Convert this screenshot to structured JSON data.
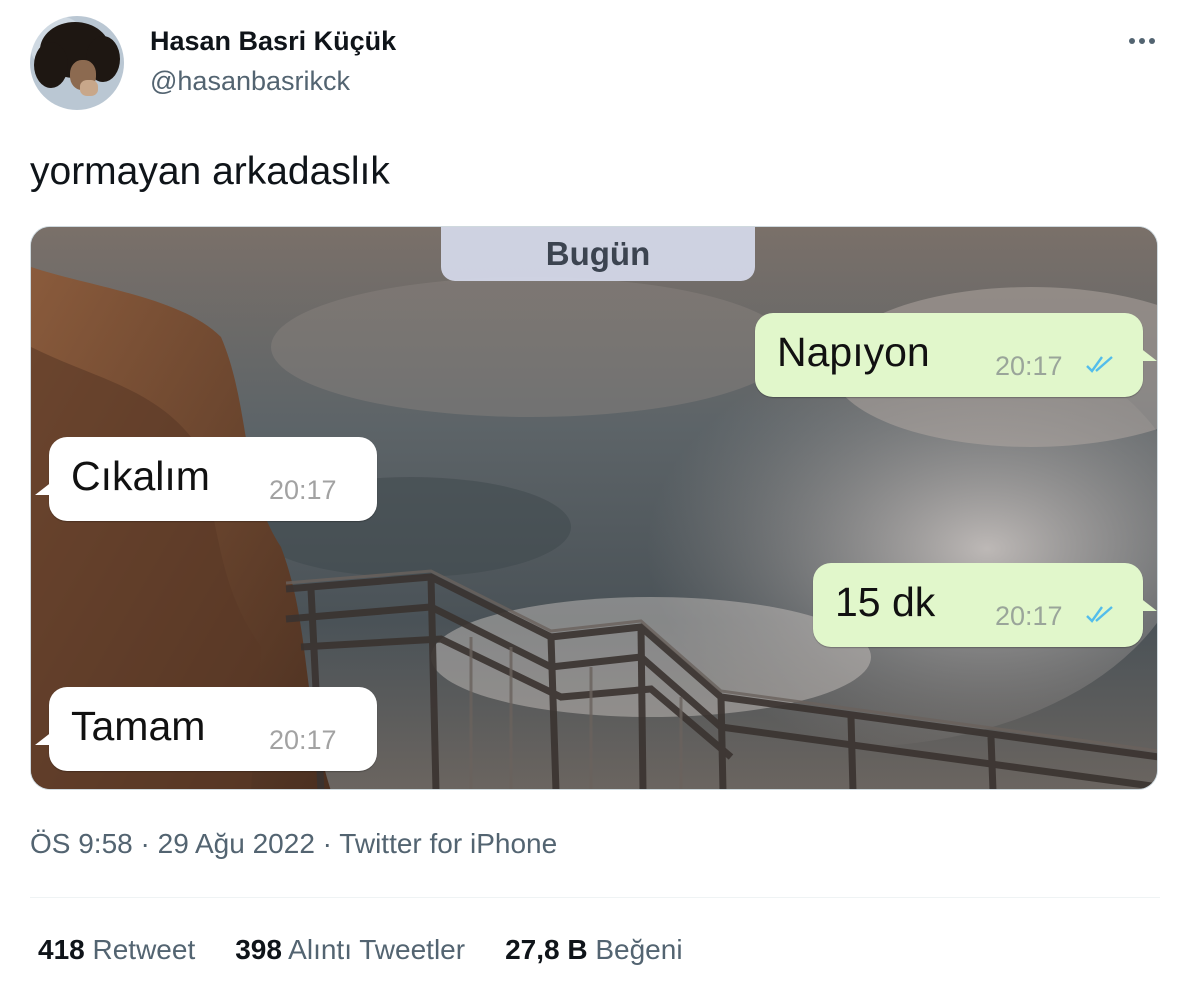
{
  "author": {
    "name": "Hasan Basri Küçük",
    "handle": "@hasanbasrikck"
  },
  "tweet": {
    "text": "yormayan arkadaslık"
  },
  "chat": {
    "date_chip": "Bugün",
    "messages": [
      {
        "direction": "out",
        "text": "Napıyon",
        "time": "20:17",
        "status": "read"
      },
      {
        "direction": "in",
        "text": "Cıkalım",
        "time": "20:17"
      },
      {
        "direction": "out",
        "text": "15 dk",
        "time": "20:17",
        "status": "read"
      },
      {
        "direction": "in",
        "text": "Tamam",
        "time": "20:17"
      }
    ],
    "colors": {
      "outgoing_bubble": "#e1f7cb",
      "incoming_bubble": "#ffffff",
      "read_ticks": "#53bdeb"
    }
  },
  "meta": {
    "time": "ÖS 9:58",
    "sep1": " · ",
    "date": "29 Ağu 2022",
    "sep2": " · ",
    "source": "Twitter for iPhone"
  },
  "stats": {
    "retweets_count": "418",
    "retweets_label": "Retweet",
    "quotes_count": "398",
    "quotes_label": "Alıntı Tweetler",
    "likes_count": "27,8 B",
    "likes_label": "Beğeni"
  },
  "icons": {
    "more": "more-dots-icon",
    "read_receipt": "double-check-icon"
  }
}
